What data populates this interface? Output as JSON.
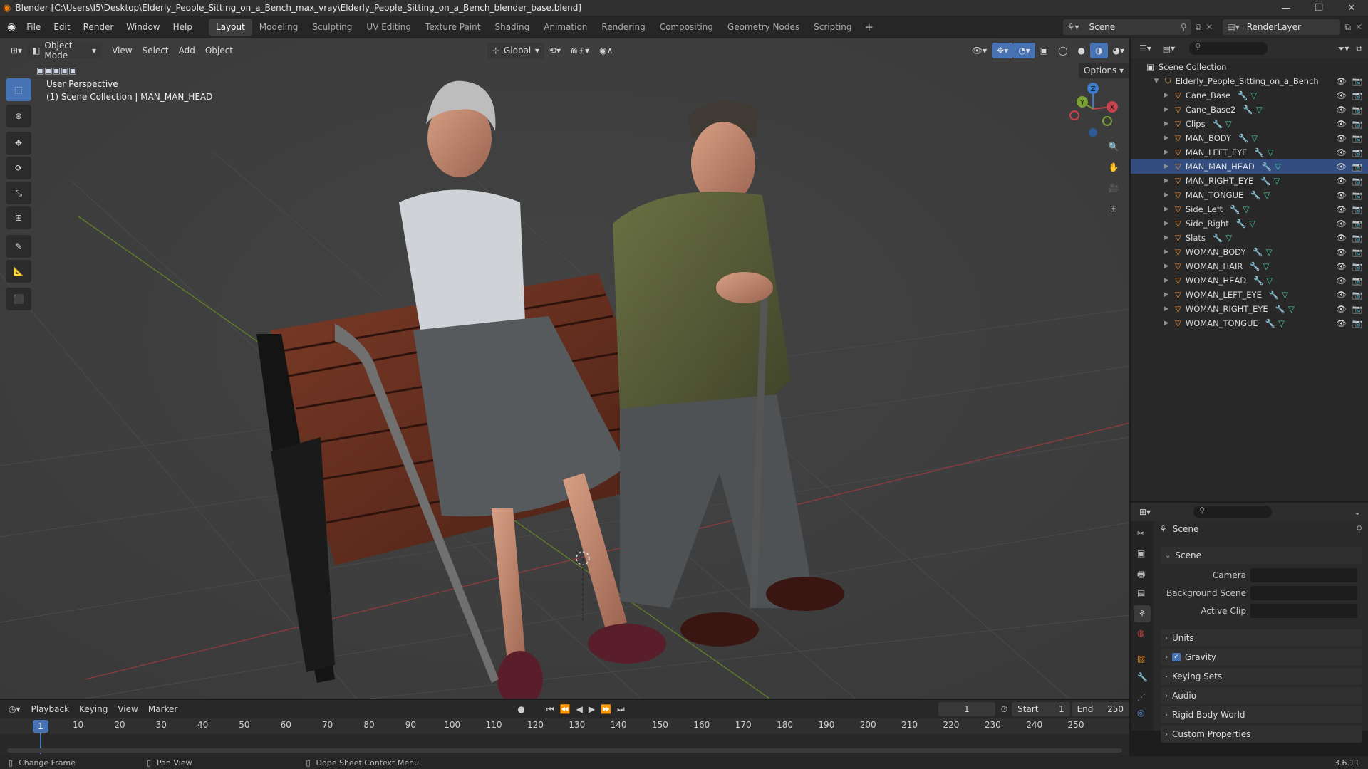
{
  "window": {
    "title": "Blender [C:\\Users\\I5\\Desktop\\Elderly_People_Sitting_on_a_Bench_max_vray\\Elderly_People_Sitting_on_a_Bench_blender_base.blend]",
    "minimize_icon": "minimize-icon",
    "maximize_icon": "maximize-icon",
    "close_icon": "close-icon"
  },
  "menu": [
    "File",
    "Edit",
    "Render",
    "Window",
    "Help"
  ],
  "workspaces": [
    "Layout",
    "Modeling",
    "Sculpting",
    "UV Editing",
    "Texture Paint",
    "Shading",
    "Animation",
    "Rendering",
    "Compositing",
    "Geometry Nodes",
    "Scripting"
  ],
  "active_workspace": "Layout",
  "scene_field": "Scene",
  "view_layer_field": "RenderLayer",
  "viewport": {
    "mode": "Object Mode",
    "menus": [
      "View",
      "Select",
      "Add",
      "Object"
    ],
    "orientation": "Global",
    "options_label": "Options",
    "overlay_line1": "User Perspective",
    "overlay_line2": "(1) Scene Collection | MAN_MAN_HEAD",
    "gizmo": {
      "x": "X",
      "y": "Y",
      "z": "Z"
    },
    "colors": {
      "x_axis": "#c8424e",
      "y_axis": "#79a134",
      "z_axis": "#3d7bcc",
      "background": "#3d3d3d"
    }
  },
  "outliner": {
    "root": "Scene Collection",
    "collection": "Elderly_People_Sitting_on_a_Bench",
    "objects": [
      "Cane_Base",
      "Cane_Base2",
      "Clips",
      "MAN_BODY",
      "MAN_LEFT_EYE",
      "MAN_MAN_HEAD",
      "MAN_RIGHT_EYE",
      "MAN_TONGUE",
      "Side_Left",
      "Side_Right",
      "Slats",
      "WOMAN_BODY",
      "WOMAN_HAIR",
      "WOMAN_HEAD",
      "WOMAN_LEFT_EYE",
      "WOMAN_RIGHT_EYE",
      "WOMAN_TONGUE"
    ],
    "active_object": "MAN_MAN_HEAD"
  },
  "properties": {
    "header": "Scene",
    "section": "Scene",
    "fields": [
      {
        "label": "Camera",
        "value": ""
      },
      {
        "label": "Background Scene",
        "value": ""
      },
      {
        "label": "Active Clip",
        "value": ""
      }
    ],
    "panels": [
      "Units",
      "Gravity",
      "Keying Sets",
      "Audio",
      "Rigid Body World",
      "Custom Properties"
    ],
    "gravity_checked": true
  },
  "timeline": {
    "menus": [
      "Playback",
      "Keying",
      "View",
      "Marker"
    ],
    "current_frame": "1",
    "start_label": "Start",
    "start": "1",
    "end_label": "End",
    "end": "250",
    "ticks": [
      "1",
      "10",
      "20",
      "30",
      "40",
      "50",
      "60",
      "70",
      "80",
      "90",
      "100",
      "110",
      "120",
      "130",
      "140",
      "150",
      "160",
      "170",
      "180",
      "190",
      "200",
      "210",
      "220",
      "230",
      "240",
      "250"
    ]
  },
  "status": {
    "items": [
      "Change Frame",
      "Pan View",
      "Dope Sheet Context Menu"
    ],
    "version": "3.6.11"
  },
  "accent": "#4772b3"
}
